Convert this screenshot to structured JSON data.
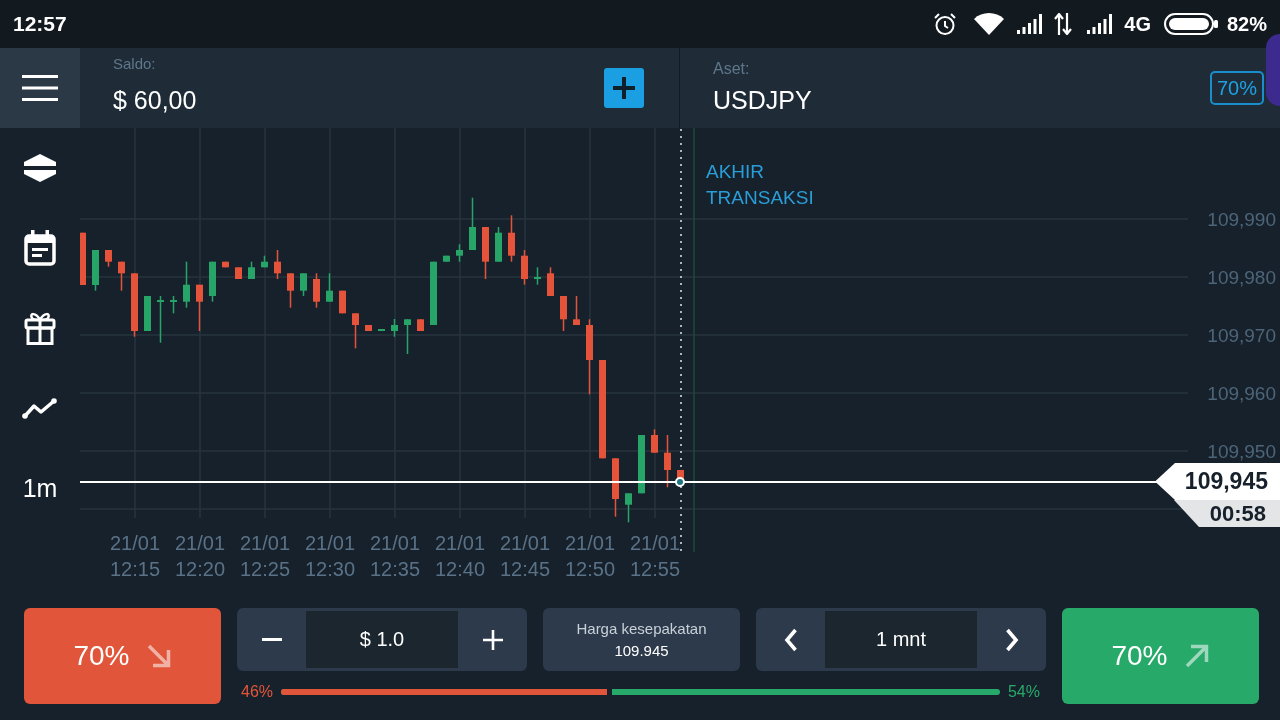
{
  "status_bar": {
    "time": "12:57",
    "network": "4G",
    "battery": "82%"
  },
  "header": {
    "balance_label": "Saldo:",
    "balance": "$ 60,00",
    "asset_label": "Aset:",
    "asset": "USDJPY",
    "payout": "70%"
  },
  "sidebar": {
    "timeframe": "1m"
  },
  "chart": {
    "expiry_label": "AKHIR TRANSAKSI",
    "y_labels": [
      "109,990",
      "109,980",
      "109,970",
      "109,960",
      "109,950"
    ],
    "x_labels": [
      {
        "date": "21/01",
        "time": "12:15"
      },
      {
        "date": "21/01",
        "time": "12:20"
      },
      {
        "date": "21/01",
        "time": "12:25"
      },
      {
        "date": "21/01",
        "time": "12:30"
      },
      {
        "date": "21/01",
        "time": "12:35"
      },
      {
        "date": "21/01",
        "time": "12:40"
      },
      {
        "date": "21/01",
        "time": "12:45"
      },
      {
        "date": "21/01",
        "time": "12:50"
      },
      {
        "date": "21/01",
        "time": "12:55"
      }
    ],
    "price": "109,945",
    "countdown": "00:58"
  },
  "trade": {
    "sell": {
      "payout": "70%"
    },
    "amount": "$ 1.0",
    "strike": {
      "label": "Harga kesepakatan",
      "value": "109.945"
    },
    "duration": "1 mnt",
    "buy": {
      "payout": "70%"
    },
    "sentiment": {
      "down": "46%",
      "up": "54%",
      "level": 0.46
    }
  }
}
